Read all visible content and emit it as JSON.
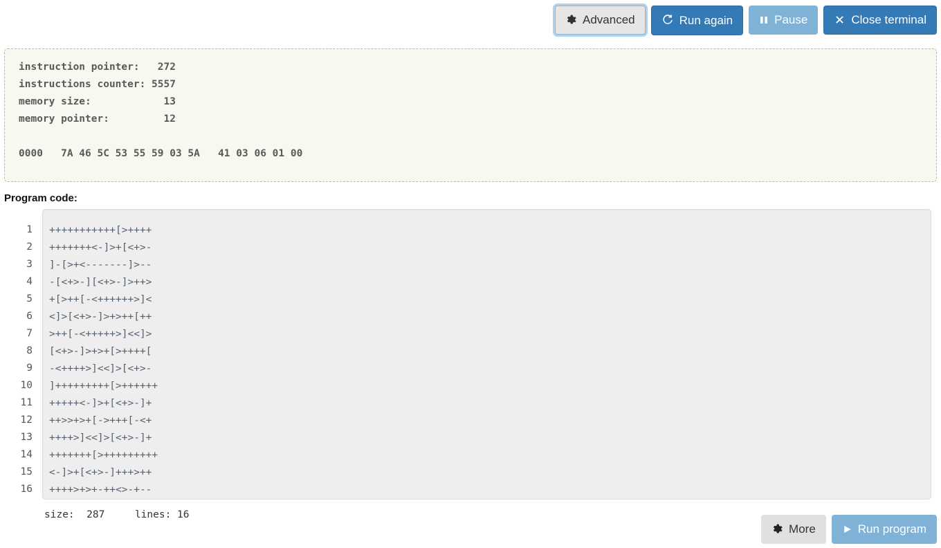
{
  "toolbar": {
    "buttons": [
      {
        "label": "Advanced",
        "icon": "gear-icon",
        "style": "default"
      },
      {
        "label": "Run again",
        "icon": "refresh-icon",
        "style": "primary"
      },
      {
        "label": "Pause",
        "icon": "pause-icon",
        "style": "primary-light"
      },
      {
        "label": "Close terminal",
        "icon": "close-x-icon",
        "style": "primary"
      }
    ]
  },
  "terminal": {
    "text": "instruction pointer:   272\ninstructions counter: 5557\nmemory size:            13\nmemory pointer:         12\n\n0000   7A 46 5C 53 55 59 03 5A   41 03 06 01 00",
    "fields": [
      {
        "name": "instruction pointer",
        "value": "272"
      },
      {
        "name": "instructions counter",
        "value": "5557"
      },
      {
        "name": "memory size",
        "value": "13"
      },
      {
        "name": "memory pointer",
        "value": "12"
      }
    ],
    "memory_dump": {
      "offset": "0000",
      "bytes": [
        "7A",
        "46",
        "5C",
        "53",
        "55",
        "59",
        "03",
        "5A",
        "41",
        "03",
        "06",
        "01",
        "00"
      ]
    }
  },
  "editor": {
    "label": "Program code:",
    "line_numbers": [
      "1",
      "2",
      "3",
      "4",
      "5",
      "6",
      "7",
      "8",
      "9",
      "10",
      "11",
      "12",
      "13",
      "14",
      "15",
      "16"
    ],
    "lines": [
      "+++++++++++[>++++",
      "+++++++<-]>+[<+>-",
      "]-[>+<-------]>--",
      "-[<+>-][<+>-]>++>",
      "+[>++[-<++++++>]<",
      "<]>[<+>-]>+>++[++",
      ">++[-<+++++>]<<]>",
      "[<+>-]>+>+[>++++[",
      "-<++++>]<<]>[<+>-",
      "]+++++++++[>++++++",
      "+++++<-]>+[<+>-]+",
      "++>>+>+[->+++[-<+",
      "++++>]<<]>[<+>-]+",
      "+++++++[>+++++++++",
      "<-]>+[<+>-]+++>++",
      "++++>+>+-++<>-+--"
    ]
  },
  "status": {
    "text": "size:  287     lines: 16",
    "size_label": "size:",
    "size_value": "287",
    "lines_label": "lines:",
    "lines_value": "16"
  },
  "bottombar": {
    "buttons": [
      {
        "label": "More",
        "icon": "gear-icon",
        "style": "plain-default"
      },
      {
        "label": "Run program",
        "icon": "play-icon",
        "style": "primary-light"
      }
    ]
  },
  "colors": {
    "primary": "#337ab7",
    "primary_light": "#7fb2d6",
    "default_button": "#e6e6e6",
    "terminal_bg": "#f8f8f0",
    "editor_bg": "#eeeeee",
    "code_text": "#55606e"
  }
}
